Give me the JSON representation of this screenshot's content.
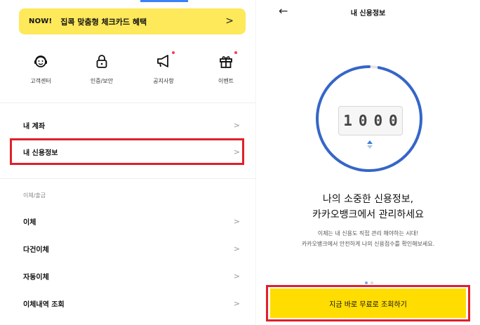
{
  "left": {
    "banner": {
      "badge": "NOW!",
      "text": "집콕 맞춤형 체크카드 혜택",
      "chevron": ">"
    },
    "quick_menu": [
      {
        "icon": "headset-smile-icon",
        "label": "고객센터",
        "new": false
      },
      {
        "icon": "lock-icon",
        "label": "인증/보안",
        "new": true
      },
      {
        "icon": "megaphone-icon",
        "label": "공지사항",
        "new": true
      },
      {
        "icon": "gift-icon",
        "label": "이벤트",
        "new": true
      }
    ],
    "menu_top": [
      {
        "label": "내 계좌"
      },
      {
        "label": "내 신용정보"
      }
    ],
    "section": "이체/출금",
    "menu_transfer": [
      {
        "label": "이체"
      },
      {
        "label": "다건이체"
      },
      {
        "label": "자동이체"
      },
      {
        "label": "이체내역 조회"
      }
    ],
    "arrow": ">"
  },
  "right": {
    "title": "내 신용정보",
    "back": "←",
    "counter_digits": [
      "1",
      "0",
      "0",
      "0"
    ],
    "gauge_fill": 0.97,
    "headline_1": "나의 소중한 신용정보,",
    "headline_2": "카카오뱅크에서 관리하세요",
    "sub_1": "이제는 내 신용도 직접 관리 해야하는 시대!",
    "sub_2": "카카오뱅크에서 안전하게 나의 신용점수를 확인해보세요.",
    "page_total": 2,
    "page_current": 1,
    "cta": "지금 바로 무료로 조회하기",
    "colors": {
      "gauge": "#3566c9",
      "gauge_track": "#e6e6e6",
      "cta": "#ffdd00",
      "highlight": "#e0202a",
      "dot_active": "#7fa4e6",
      "dot_inactive": "#d9d9d9"
    }
  }
}
